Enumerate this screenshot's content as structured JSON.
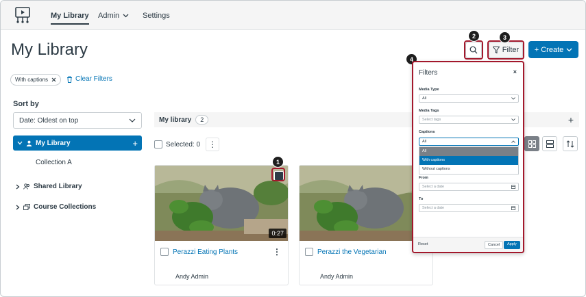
{
  "nav": {
    "items": [
      {
        "label": "My Library"
      },
      {
        "label": "Admin"
      },
      {
        "label": "Settings"
      }
    ]
  },
  "page": {
    "title": "My Library"
  },
  "toolbar": {
    "filter_label": "Filter",
    "create_label": "+ Create"
  },
  "active_filter": {
    "label": "With captions",
    "clear_label": "Clear Filters"
  },
  "sort": {
    "label": "Sort by",
    "value": "Date: Oldest on top"
  },
  "tree": {
    "my_library": "My Library",
    "collection_a": "Collection A",
    "shared_library": "Shared Library",
    "course_collections": "Course Collections"
  },
  "library_bar": {
    "title": "My library",
    "count": "2"
  },
  "selection": {
    "label": "Selected: 0"
  },
  "cards": [
    {
      "title": "Perazzi Eating Plants",
      "author": "Andy Admin",
      "duration": "0:27"
    },
    {
      "title": "Perazzi the Vegetarian",
      "author": "Andy Admin",
      "duration": ""
    }
  ],
  "filters_panel": {
    "title": "Filters",
    "close": "×",
    "media_type_label": "Media Type",
    "media_type_value": "All",
    "media_tags_label": "Media Tags",
    "media_tags_placeholder": "Select tags",
    "captions_label": "Captions",
    "captions_value": "All",
    "captions_options": [
      "All",
      "With captions",
      "Without captions"
    ],
    "from_label": "From",
    "from_placeholder": "Select a date",
    "to_label": "To",
    "to_placeholder": "Select a date",
    "reset_label": "Reset",
    "cancel_label": "Cancel",
    "apply_label": "Apply"
  },
  "callouts": [
    "1",
    "2",
    "3",
    "4"
  ],
  "colors": {
    "accent": "#0374b5",
    "highlight": "#a3182c",
    "text": "#2d3b45"
  }
}
